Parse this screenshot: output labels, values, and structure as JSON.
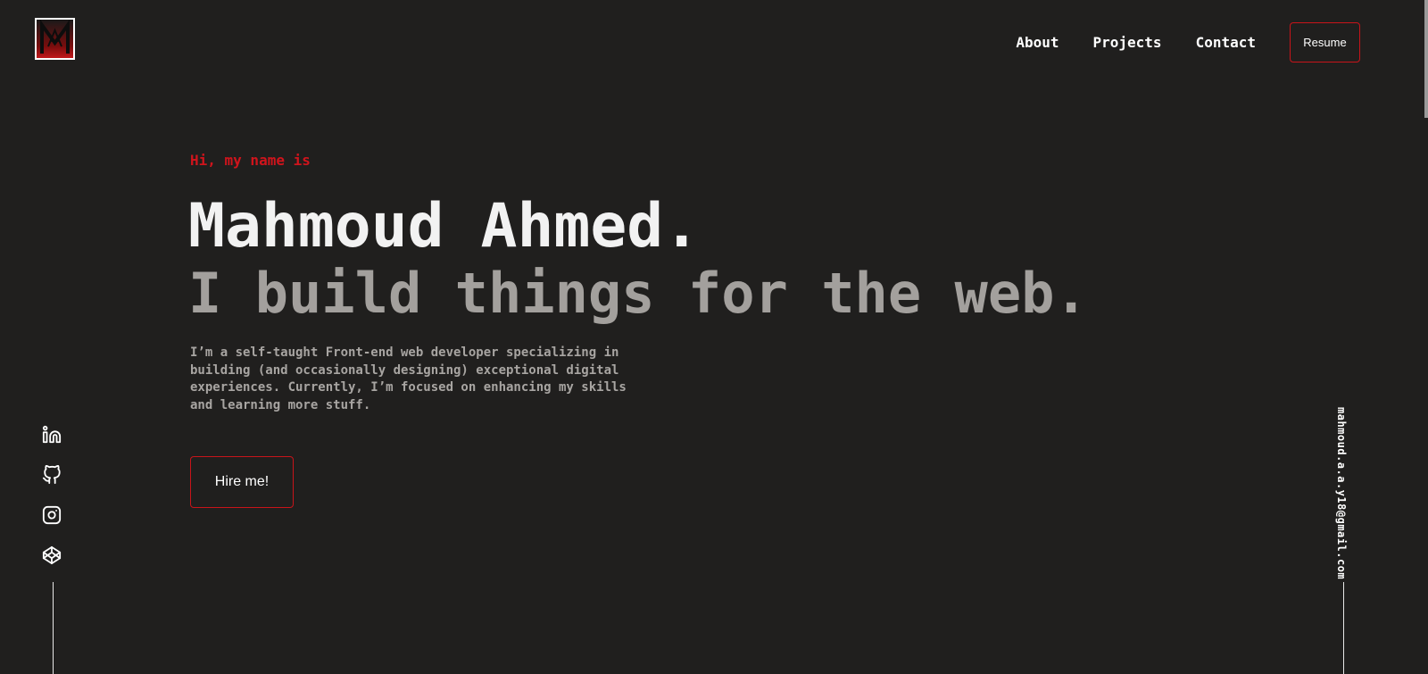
{
  "brand": {
    "logo_icon": "monogram-logo-icon",
    "accent_color": "#c8141a",
    "background_color": "#201f1e"
  },
  "nav": {
    "links": [
      {
        "label": "About"
      },
      {
        "label": "Projects"
      },
      {
        "label": "Contact"
      }
    ],
    "resume_label": "Resume"
  },
  "hero": {
    "greeting": "Hi, my name is",
    "name": "Mahmoud Ahmed.",
    "tagline": "I build things for the web.",
    "intro": "I’m a self-taught Front-end web developer specializing in building (and occasionally designing) exceptional digital experiences. Currently, I’m focused on enhancing my skills and learning more stuff.",
    "cta_label": "Hire me!"
  },
  "social": {
    "icons": [
      "linkedin-icon",
      "github-icon",
      "instagram-icon",
      "codepen-icon"
    ]
  },
  "contact": {
    "email": "mahmoud.a.a.y18@gmail.com"
  }
}
